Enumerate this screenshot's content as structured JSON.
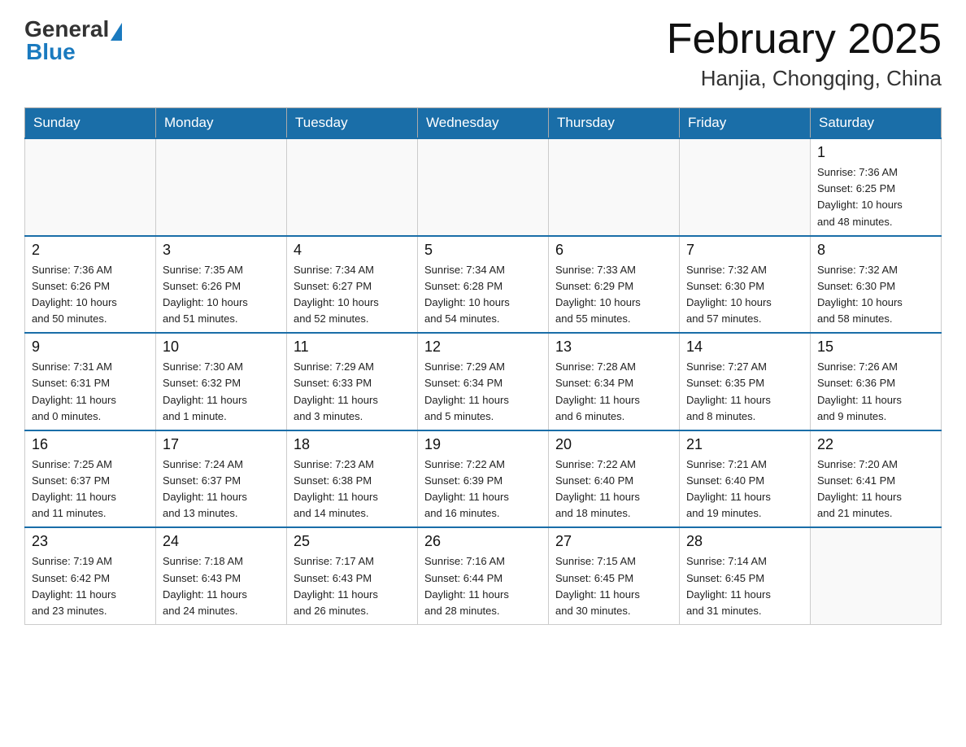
{
  "header": {
    "logo_general": "General",
    "logo_blue": "Blue",
    "title": "February 2025",
    "subtitle": "Hanjia, Chongqing, China"
  },
  "weekdays": [
    "Sunday",
    "Monday",
    "Tuesday",
    "Wednesday",
    "Thursday",
    "Friday",
    "Saturday"
  ],
  "weeks": [
    [
      {
        "day": "",
        "info": ""
      },
      {
        "day": "",
        "info": ""
      },
      {
        "day": "",
        "info": ""
      },
      {
        "day": "",
        "info": ""
      },
      {
        "day": "",
        "info": ""
      },
      {
        "day": "",
        "info": ""
      },
      {
        "day": "1",
        "info": "Sunrise: 7:36 AM\nSunset: 6:25 PM\nDaylight: 10 hours\nand 48 minutes."
      }
    ],
    [
      {
        "day": "2",
        "info": "Sunrise: 7:36 AM\nSunset: 6:26 PM\nDaylight: 10 hours\nand 50 minutes."
      },
      {
        "day": "3",
        "info": "Sunrise: 7:35 AM\nSunset: 6:26 PM\nDaylight: 10 hours\nand 51 minutes."
      },
      {
        "day": "4",
        "info": "Sunrise: 7:34 AM\nSunset: 6:27 PM\nDaylight: 10 hours\nand 52 minutes."
      },
      {
        "day": "5",
        "info": "Sunrise: 7:34 AM\nSunset: 6:28 PM\nDaylight: 10 hours\nand 54 minutes."
      },
      {
        "day": "6",
        "info": "Sunrise: 7:33 AM\nSunset: 6:29 PM\nDaylight: 10 hours\nand 55 minutes."
      },
      {
        "day": "7",
        "info": "Sunrise: 7:32 AM\nSunset: 6:30 PM\nDaylight: 10 hours\nand 57 minutes."
      },
      {
        "day": "8",
        "info": "Sunrise: 7:32 AM\nSunset: 6:30 PM\nDaylight: 10 hours\nand 58 minutes."
      }
    ],
    [
      {
        "day": "9",
        "info": "Sunrise: 7:31 AM\nSunset: 6:31 PM\nDaylight: 11 hours\nand 0 minutes."
      },
      {
        "day": "10",
        "info": "Sunrise: 7:30 AM\nSunset: 6:32 PM\nDaylight: 11 hours\nand 1 minute."
      },
      {
        "day": "11",
        "info": "Sunrise: 7:29 AM\nSunset: 6:33 PM\nDaylight: 11 hours\nand 3 minutes."
      },
      {
        "day": "12",
        "info": "Sunrise: 7:29 AM\nSunset: 6:34 PM\nDaylight: 11 hours\nand 5 minutes."
      },
      {
        "day": "13",
        "info": "Sunrise: 7:28 AM\nSunset: 6:34 PM\nDaylight: 11 hours\nand 6 minutes."
      },
      {
        "day": "14",
        "info": "Sunrise: 7:27 AM\nSunset: 6:35 PM\nDaylight: 11 hours\nand 8 minutes."
      },
      {
        "day": "15",
        "info": "Sunrise: 7:26 AM\nSunset: 6:36 PM\nDaylight: 11 hours\nand 9 minutes."
      }
    ],
    [
      {
        "day": "16",
        "info": "Sunrise: 7:25 AM\nSunset: 6:37 PM\nDaylight: 11 hours\nand 11 minutes."
      },
      {
        "day": "17",
        "info": "Sunrise: 7:24 AM\nSunset: 6:37 PM\nDaylight: 11 hours\nand 13 minutes."
      },
      {
        "day": "18",
        "info": "Sunrise: 7:23 AM\nSunset: 6:38 PM\nDaylight: 11 hours\nand 14 minutes."
      },
      {
        "day": "19",
        "info": "Sunrise: 7:22 AM\nSunset: 6:39 PM\nDaylight: 11 hours\nand 16 minutes."
      },
      {
        "day": "20",
        "info": "Sunrise: 7:22 AM\nSunset: 6:40 PM\nDaylight: 11 hours\nand 18 minutes."
      },
      {
        "day": "21",
        "info": "Sunrise: 7:21 AM\nSunset: 6:40 PM\nDaylight: 11 hours\nand 19 minutes."
      },
      {
        "day": "22",
        "info": "Sunrise: 7:20 AM\nSunset: 6:41 PM\nDaylight: 11 hours\nand 21 minutes."
      }
    ],
    [
      {
        "day": "23",
        "info": "Sunrise: 7:19 AM\nSunset: 6:42 PM\nDaylight: 11 hours\nand 23 minutes."
      },
      {
        "day": "24",
        "info": "Sunrise: 7:18 AM\nSunset: 6:43 PM\nDaylight: 11 hours\nand 24 minutes."
      },
      {
        "day": "25",
        "info": "Sunrise: 7:17 AM\nSunset: 6:43 PM\nDaylight: 11 hours\nand 26 minutes."
      },
      {
        "day": "26",
        "info": "Sunrise: 7:16 AM\nSunset: 6:44 PM\nDaylight: 11 hours\nand 28 minutes."
      },
      {
        "day": "27",
        "info": "Sunrise: 7:15 AM\nSunset: 6:45 PM\nDaylight: 11 hours\nand 30 minutes."
      },
      {
        "day": "28",
        "info": "Sunrise: 7:14 AM\nSunset: 6:45 PM\nDaylight: 11 hours\nand 31 minutes."
      },
      {
        "day": "",
        "info": ""
      }
    ]
  ]
}
